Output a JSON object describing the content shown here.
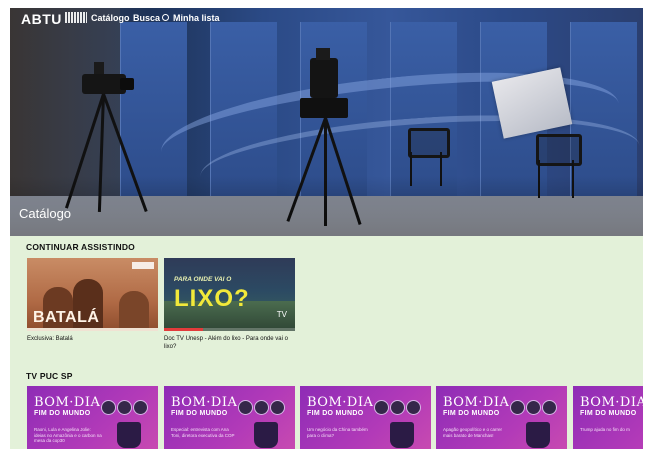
{
  "header": {
    "brand": "ABTU",
    "nav": [
      {
        "label": "Catálogo"
      },
      {
        "label": "Busca"
      },
      {
        "label": "Minha lista"
      }
    ]
  },
  "hero": {
    "title": "Catálogo"
  },
  "continue_watching": {
    "title": "CONTINUAR ASSISTINDO",
    "items": [
      {
        "thumb_text": "BATALÁ",
        "caption": "Exclusiva: Batalá"
      },
      {
        "thumb_question": "PARA ONDE VAI O",
        "thumb_text": "LIXO?",
        "thumb_badge": "TV",
        "caption": "Doc TV Unesp - Além do lixo - Para onde vai o lixo?",
        "progress": 0.3
      }
    ]
  },
  "tv_puc": {
    "title": "TV PUC SP",
    "items": [
      {
        "t1": "BOM·DIA,",
        "t2": "FIM DO MUNDO",
        "desc": "Raoni, Lula e Angelina Jolie: ideias no Amazônia e o carbon na mesa da cop30"
      },
      {
        "t1": "BOM·DIA,",
        "t2": "FIM DO MUNDO",
        "desc": "Especial: entrevista com Ana Toni, diretora executiva da COP"
      },
      {
        "t1": "BOM·DIA,",
        "t2": "FIM DO MUNDO",
        "desc": "Um negócio da China também para o clima?"
      },
      {
        "t1": "BOM·DIA,",
        "t2": "FIM DO MUNDO",
        "desc": "Apagão geopolítico e o carrer mais barato de Manchas!"
      },
      {
        "t1": "BOM·DIA,",
        "t2": "FIM DO MUNDO",
        "desc": "Trump ajuda no fim do m"
      }
    ]
  }
}
